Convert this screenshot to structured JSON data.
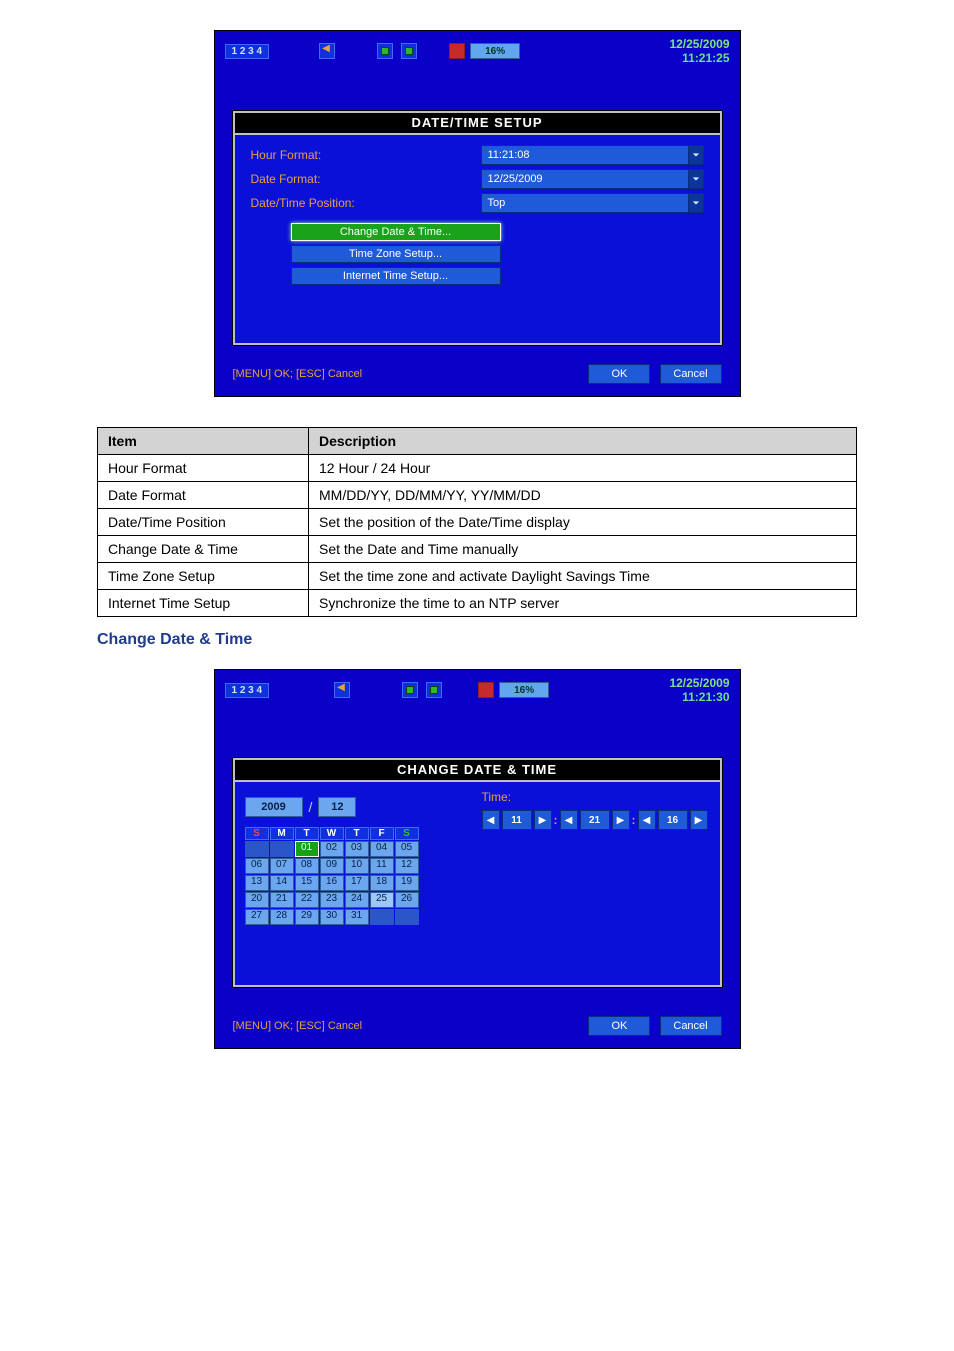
{
  "screen1": {
    "status": {
      "channels": "1 2 3 4",
      "percent": "16%",
      "date": "12/25/2009",
      "time": "11:21:25"
    },
    "panel_title": "DATE/TIME SETUP",
    "rows": {
      "hour_format_label": "Hour Format:",
      "hour_format_value": "11:21:08",
      "date_format_label": "Date Format:",
      "date_format_value": "12/25/2009",
      "dt_pos_label": "Date/Time Position:",
      "dt_pos_value": "Top"
    },
    "buttons": {
      "change": "Change Date & Time...",
      "tz": "Time Zone Setup...",
      "inet": "Internet Time Setup..."
    },
    "footer_hint": "[MENU] OK; [ESC] Cancel",
    "ok": "OK",
    "cancel": "Cancel"
  },
  "table": {
    "h1": "Item",
    "h2": "Description",
    "r1a": "Hour Format",
    "r1b": "12 Hour / 24 Hour",
    "r2a": "Date Format",
    "r2b": "MM/DD/YY, DD/MM/YY, YY/MM/DD",
    "r3a": "Date/Time Position",
    "r3b": "Set the position of the Date/Time display",
    "r4a": "Change Date & Time",
    "r4b": "Set the Date and Time manually",
    "r5a": "Time Zone Setup",
    "r5b": "Set the time zone and activate Daylight Savings Time",
    "r6a": "Internet Time Setup",
    "r6b": "Synchronize the time to an NTP server"
  },
  "section_heading": "Change Date & Time",
  "screen2": {
    "status": {
      "channels": "1 2 3 4",
      "percent": "16%",
      "date": "12/25/2009",
      "time": "11:21:30"
    },
    "panel_title": "CHANGE DATE & TIME",
    "year": "2009",
    "month": "12",
    "time_label": "Time:",
    "t_h": "11",
    "t_m": "21",
    "t_s": "16",
    "dow": [
      "S",
      "M",
      "T",
      "W",
      "T",
      "F",
      "S"
    ],
    "cal": [
      [
        "",
        "",
        "01",
        "02",
        "03",
        "04",
        "05"
      ],
      [
        "06",
        "07",
        "08",
        "09",
        "10",
        "11",
        "12"
      ],
      [
        "13",
        "14",
        "15",
        "16",
        "17",
        "18",
        "19"
      ],
      [
        "20",
        "21",
        "22",
        "23",
        "24",
        "25",
        "26"
      ],
      [
        "27",
        "28",
        "29",
        "30",
        "31",
        "",
        ""
      ]
    ],
    "footer_hint": "[MENU] OK; [ESC] Cancel",
    "ok": "OK",
    "cancel": "Cancel"
  }
}
